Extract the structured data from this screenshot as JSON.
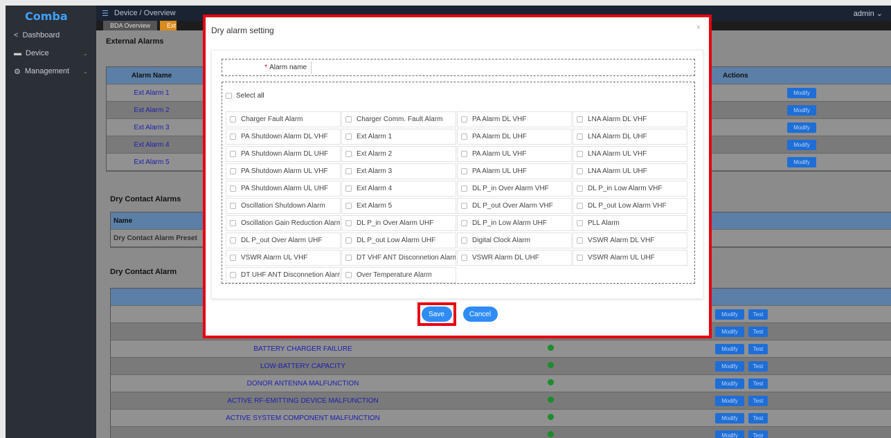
{
  "brand": "Comba",
  "sidebar": {
    "items": [
      {
        "label": "Dashboard",
        "icon": "share-icon"
      },
      {
        "label": "Device",
        "icon": "device-icon"
      },
      {
        "label": "Management",
        "icon": "gear-icon"
      }
    ]
  },
  "topbar": {
    "breadcrumb": "Device  /  Overview",
    "user": "admin"
  },
  "tabs": [
    "BDA Overview",
    "Ext"
  ],
  "background": {
    "external_alarms": {
      "title": "External Alarms",
      "col_name": "Alarm Name",
      "col_actions": "Actions",
      "rows": [
        "Ext Alarm 1",
        "Ext Alarm 2",
        "Ext Alarm 3",
        "Ext Alarm 4",
        "Ext Alarm 5"
      ],
      "modify": "Modify"
    },
    "dry_contact_alarms": {
      "title": "Dry Contact Alarms",
      "col_name": "Name",
      "row": "Dry Contact Alarm Preset"
    },
    "dry_contact_alarm": {
      "title": "Dry Contact Alarm",
      "rows": [
        "BATTERY CHARGER FAILURE",
        "LOW-BATTERY CAPACITY",
        "DONOR ANTENNA MALFUNCTION",
        "ACTIVE RF-EMITTING DEVICE MALFUNCTION",
        "ACTIVE SYSTEM COMPONENT MALFUNCTION"
      ],
      "modify": "Modify",
      "test": "Test"
    }
  },
  "modal": {
    "title": "Dry alarm setting",
    "close": "×",
    "name_label": "Alarm name",
    "select_all": "Select all",
    "alarms": [
      "Charger Fault Alarm",
      "Charger Comm. Fault Alarm",
      "PA Alarm DL VHF",
      "LNA Alarm DL VHF",
      "PA Shutdown Alarm DL VHF",
      "Ext Alarm 1",
      "PA Alarm DL UHF",
      "LNA Alarm DL UHF",
      "PA Shutdown Alarm DL UHF",
      "Ext Alarm 2",
      "PA Alarm UL VHF",
      "LNA Alarm UL VHF",
      "PA Shutdown Alarm UL VHF",
      "Ext Alarm 3",
      "PA Alarm UL UHF",
      "LNA Alarm UL UHF",
      "PA Shutdown Alarm UL UHF",
      "Ext Alarm 4",
      "DL P_in Over Alarm VHF",
      "DL P_in Low Alarm VHF",
      "Oscillation Shutdown Alarm",
      "Ext Alarm 5",
      "DL P_out Over Alarm VHF",
      "DL P_out Low Alarm VHF",
      "Oscillation Gain Reduction Alarm",
      "DL P_in Over Alarm UHF",
      "DL P_in Low Alarm UHF",
      "PLL Alarm",
      "DL P_out Over Alarm UHF",
      "DL P_out Low Alarm UHF",
      "Digital Clock Alarm",
      "VSWR Alarm DL VHF",
      "VSWR Alarm UL VHF",
      "DT VHF ANT Disconnetion Alarm",
      "VSWR Alarm DL UHF",
      "VSWR Alarm UL UHF",
      "DT UHF ANT Disconnetion Alarm",
      "Over Temperature Alarm"
    ],
    "save": "Save",
    "cancel": "Cancel"
  },
  "colors": {
    "accent": "#2f8cf5",
    "highlight": "#e60012",
    "status_ok": "#1c8c2c",
    "brand": "#3ea2ff"
  }
}
